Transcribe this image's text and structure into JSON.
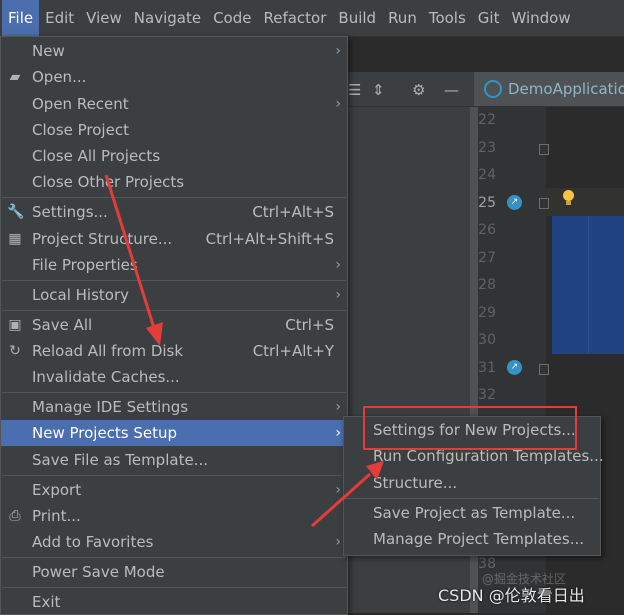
{
  "menubar": {
    "items": [
      "File",
      "Edit",
      "View",
      "Navigate",
      "Code",
      "Refactor",
      "Build",
      "Run",
      "Tools",
      "Git",
      "Window"
    ],
    "active": "File"
  },
  "editor": {
    "tab_title": "DemoApplication",
    "line_numbers": [
      "22",
      "23",
      "24",
      "25",
      "26",
      "27",
      "28",
      "29",
      "30",
      "31",
      "32",
      "38"
    ],
    "current_line": "25"
  },
  "file_menu": {
    "items": [
      {
        "label": "New",
        "arrow": true
      },
      {
        "label": "Open...",
        "icon": "folder-icon"
      },
      {
        "label": "Open Recent",
        "arrow": true
      },
      {
        "label": "Close Project"
      },
      {
        "label": "Close All Projects"
      },
      {
        "label": "Close Other Projects"
      },
      {
        "label": "Settings...",
        "shortcut": "Ctrl+Alt+S",
        "icon": "wrench-icon"
      },
      {
        "label": "Project Structure...",
        "shortcut": "Ctrl+Alt+Shift+S",
        "icon": "project-structure-icon"
      },
      {
        "label": "File Properties",
        "arrow": true
      },
      {
        "label": "Local History",
        "arrow": true
      },
      {
        "label": "Save All",
        "shortcut": "Ctrl+S",
        "icon": "save-icon"
      },
      {
        "label": "Reload All from Disk",
        "shortcut": "Ctrl+Alt+Y",
        "icon": "reload-icon"
      },
      {
        "label": "Invalidate Caches..."
      },
      {
        "label": "Manage IDE Settings",
        "arrow": true
      },
      {
        "label": "New Projects Setup",
        "arrow": true,
        "highlighted": true
      },
      {
        "label": "Save File as Template..."
      },
      {
        "label": "Export",
        "arrow": true
      },
      {
        "label": "Print...",
        "icon": "printer-icon"
      },
      {
        "label": "Add to Favorites",
        "arrow": true
      },
      {
        "label": "Power Save Mode"
      },
      {
        "label": "Exit"
      }
    ]
  },
  "submenu": {
    "items": [
      {
        "label": "Settings for New Projects..."
      },
      {
        "label": "Run Configuration Templates..."
      },
      {
        "label": "Structure..."
      },
      {
        "label": "Save Project as Template..."
      },
      {
        "label": "Manage Project Templates..."
      }
    ]
  },
  "watermark": {
    "text": "CSDN @伦敦看日出",
    "faint_text": "@掘金技术社区"
  },
  "colors": {
    "highlight": "#4b6eaf",
    "menu_bg": "#3c3f41",
    "annotation_red": "#e43b3b"
  }
}
